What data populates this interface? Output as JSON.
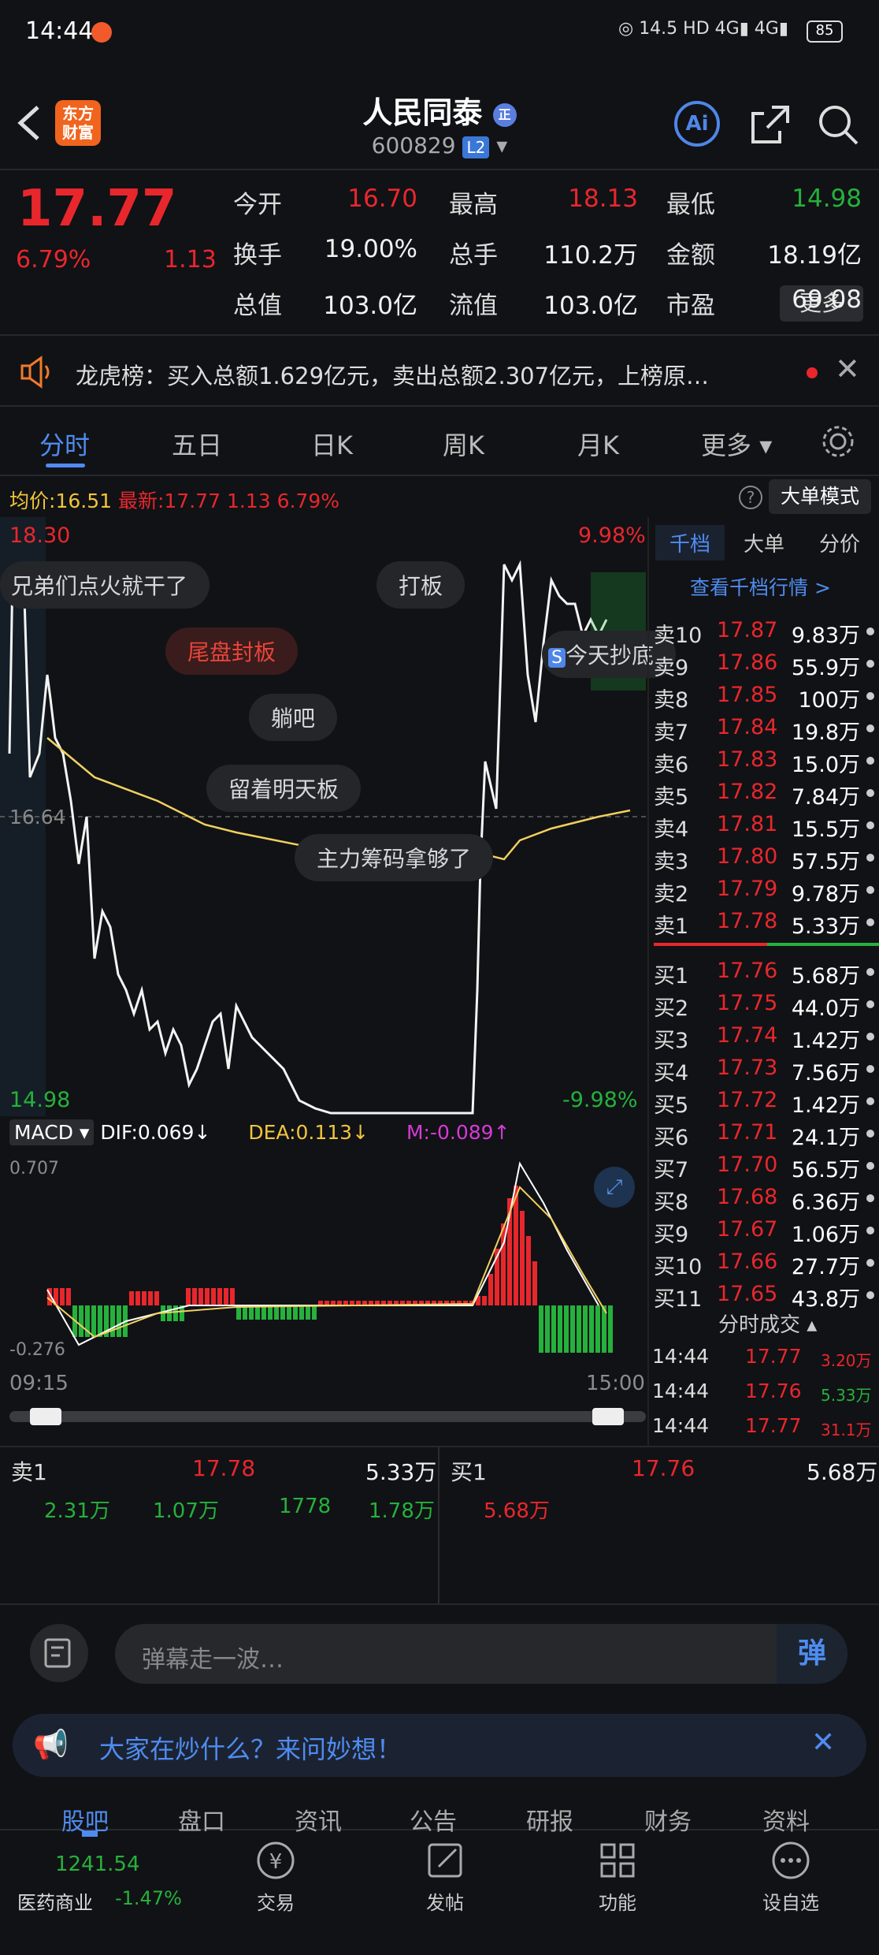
{
  "status": {
    "time": "14:44",
    "speed": "14.5\nK/s",
    "battery": "85"
  },
  "header": {
    "logo": "东方财富",
    "title": "人民同泰",
    "code": "600829",
    "l2": "L2"
  },
  "quote": {
    "price": "17.77",
    "pct": "6.79%",
    "chg": "1.13",
    "fields": [
      {
        "label": "今开",
        "value": "16.70",
        "color": "red"
      },
      {
        "label": "最高",
        "value": "18.13",
        "color": "red"
      },
      {
        "label": "最低",
        "value": "14.98",
        "color": "green"
      },
      {
        "label": "换手",
        "value": "19.00%",
        "color": "white"
      },
      {
        "label": "总手",
        "value": "110.2万",
        "color": "white"
      },
      {
        "label": "金额",
        "value": "18.19亿",
        "color": "white"
      },
      {
        "label": "总值",
        "value": "103.0亿",
        "color": "white"
      },
      {
        "label": "流值",
        "value": "103.0亿",
        "color": "white"
      },
      {
        "label": "市盈",
        "value": "69.08",
        "color": "white"
      }
    ],
    "more": "更多"
  },
  "notice": "龙虎榜：买入总额1.629亿元，卖出总额2.307亿元，上榜原…",
  "tabs": [
    "分时",
    "五日",
    "日K",
    "周K",
    "月K",
    "更多"
  ],
  "chart_header": {
    "avg_label": "均价:",
    "avg": "16.51",
    "latest_label": "最新:",
    "latest": "17.77",
    "chg": "1.13",
    "pct": "6.79%",
    "mode": "大单模式"
  },
  "chart": {
    "top": "18.30",
    "bottom": "14.98",
    "top_pct": "9.98%",
    "bottom_pct": "-9.98%",
    "mid": "16.64",
    "start": "09:15",
    "end": "15:00"
  },
  "danmaku": [
    "兄弟们点火就干了",
    "打板",
    "尾盘封板",
    "躺吧",
    "留着明天板",
    "主力筹码拿够了",
    "今天抄底"
  ],
  "macd": {
    "name": "MACD",
    "dif": "DIF:0.069",
    "dea": "DEA:0.113",
    "m": "M:-0.089",
    "top": "0.707",
    "bottom": "-0.276"
  },
  "ob_tabs": [
    "千档",
    "大单",
    "分价"
  ],
  "ob_link": "查看千档行情 >",
  "asks": [
    [
      "卖10",
      "17.87",
      "9.83万"
    ],
    [
      "卖9",
      "17.86",
      "55.9万"
    ],
    [
      "卖8",
      "17.85",
      "100万"
    ],
    [
      "卖7",
      "17.84",
      "19.8万"
    ],
    [
      "卖6",
      "17.83",
      "15.0万"
    ],
    [
      "卖5",
      "17.82",
      "7.84万"
    ],
    [
      "卖4",
      "17.81",
      "15.5万"
    ],
    [
      "卖3",
      "17.80",
      "57.5万"
    ],
    [
      "卖2",
      "17.79",
      "9.78万"
    ],
    [
      "卖1",
      "17.78",
      "5.33万"
    ]
  ],
  "bids": [
    [
      "买1",
      "17.76",
      "5.68万"
    ],
    [
      "买2",
      "17.75",
      "44.0万"
    ],
    [
      "买3",
      "17.74",
      "1.42万"
    ],
    [
      "买4",
      "17.73",
      "7.56万"
    ],
    [
      "买5",
      "17.72",
      "1.42万"
    ],
    [
      "买6",
      "17.71",
      "24.1万"
    ],
    [
      "买7",
      "17.70",
      "56.5万"
    ],
    [
      "买8",
      "17.68",
      "6.36万"
    ],
    [
      "买9",
      "17.67",
      "1.06万"
    ],
    [
      "买10",
      "17.66",
      "27.7万"
    ],
    [
      "买11",
      "17.65",
      "43.8万"
    ]
  ],
  "ticks_title": "分时成交",
  "ticks": [
    [
      "14:44",
      "17.77",
      "3.20万"
    ],
    [
      "14:44",
      "17.76",
      "5.33万"
    ],
    [
      "14:44",
      "17.77",
      "31.1万"
    ]
  ],
  "summary": {
    "ask_label": "卖1",
    "ask_price": "17.78",
    "ask_vol": "5.33万",
    "bid_label": "买1",
    "bid_price": "17.76",
    "bid_vol": "5.68万",
    "q": [
      "2.31万",
      "1.07万",
      "1778",
      "1.78万"
    ],
    "bq": "5.68万"
  },
  "comment": {
    "placeholder": "弹幕走一波…",
    "btn": "弹"
  },
  "banner": "大家在炒什么？来问妙想！",
  "bottom_tabs": [
    "股吧",
    "盘口",
    "资讯",
    "公告",
    "研报",
    "财务",
    "资料"
  ],
  "index": {
    "value": "1241.54",
    "name": "医药商业",
    "pct": "-1.47%"
  },
  "actions": [
    "交易",
    "发帖",
    "功能",
    "设自选"
  ]
}
